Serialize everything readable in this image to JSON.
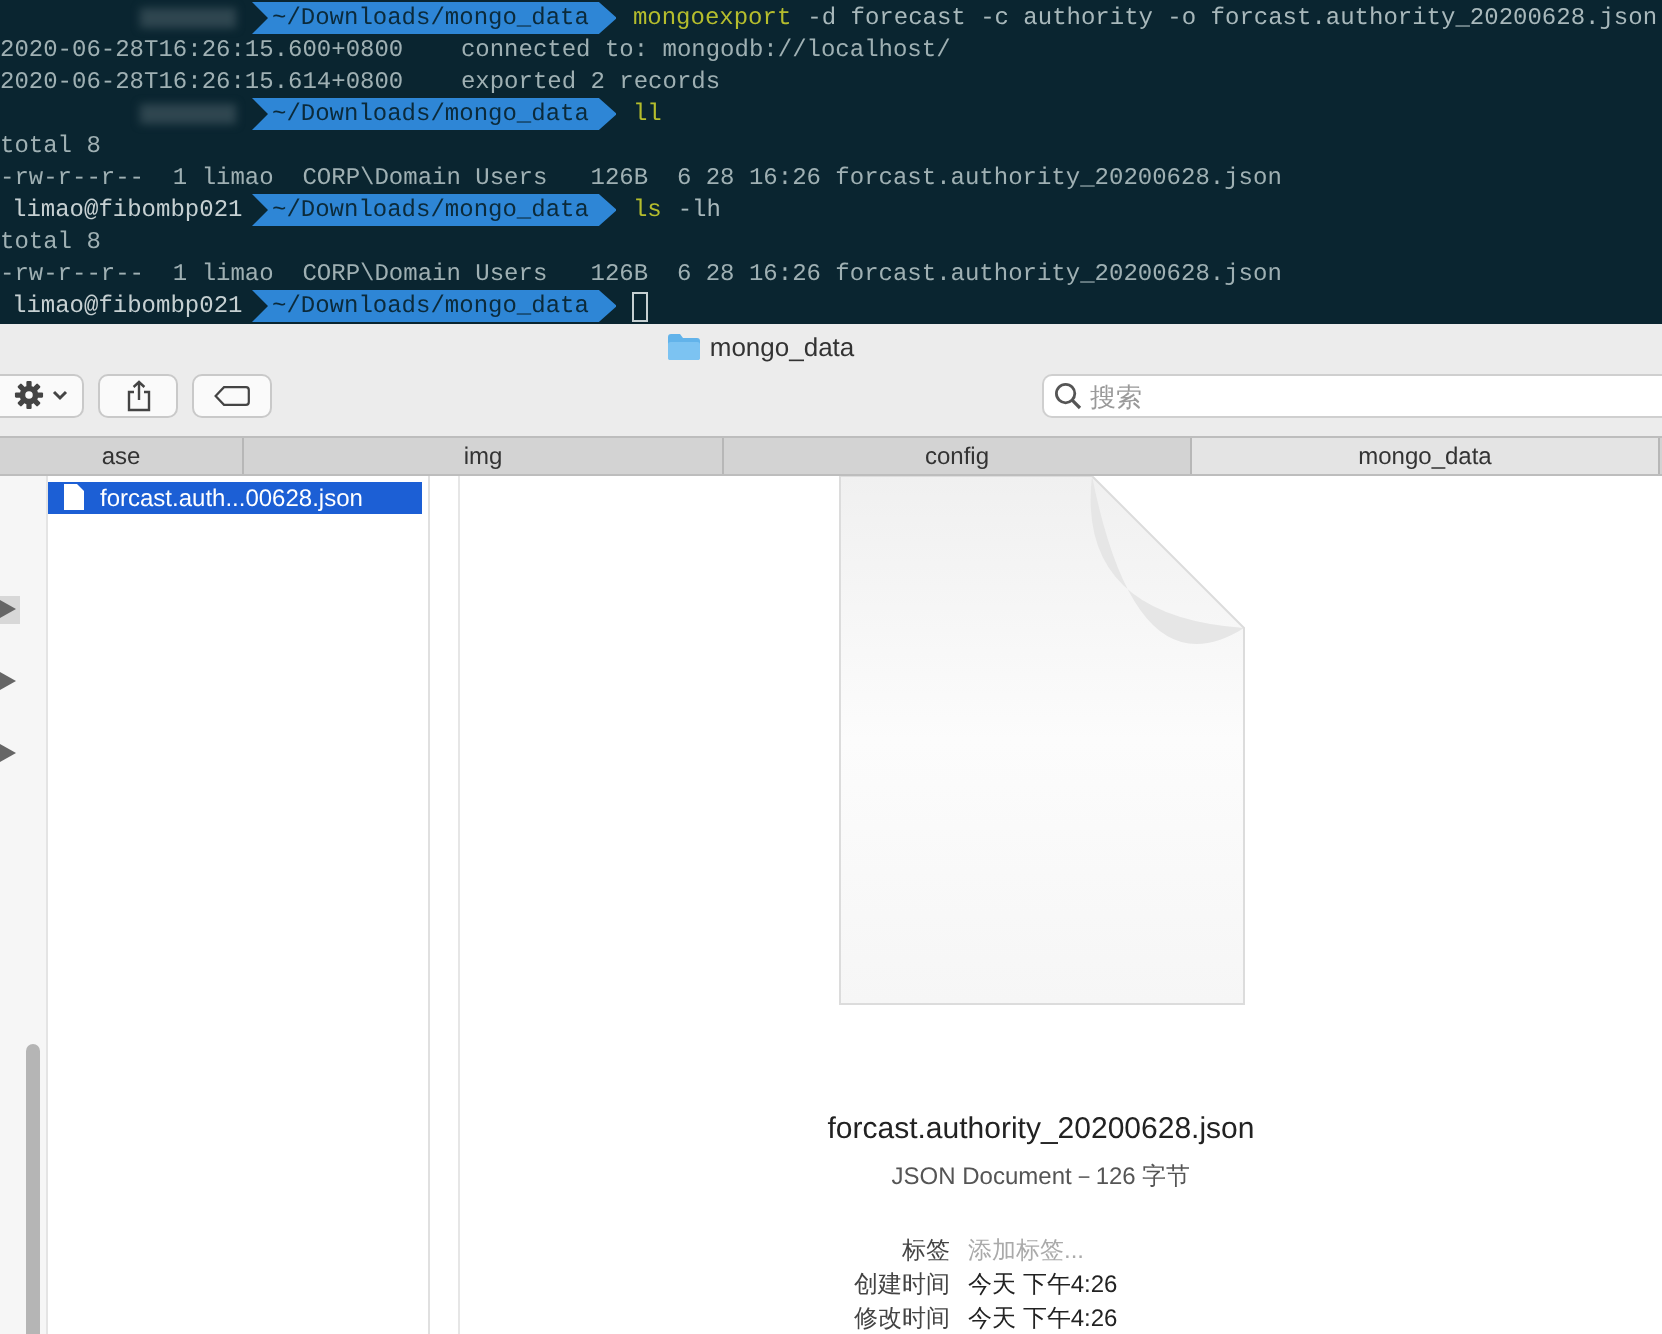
{
  "terminal": {
    "lines": [
      {
        "kind": "prompt",
        "blurred": true,
        "path": "~/Downloads/mongo_data",
        "command": "mongoexport",
        "args": "-d forecast -c authority -o forcast.authority_20200628.json"
      },
      {
        "kind": "output",
        "text": "2020-06-28T16:26:15.600+0800    connected to: mongodb://localhost/"
      },
      {
        "kind": "output",
        "text": "2020-06-28T16:26:15.614+0800    exported 2 records"
      },
      {
        "kind": "prompt",
        "blurred": true,
        "path": "~/Downloads/mongo_data",
        "command": "ll"
      },
      {
        "kind": "output",
        "text": "total 8"
      },
      {
        "kind": "output",
        "text": "-rw-r--r--  1 limao  CORP\\Domain Users   126B  6 28 16:26 forcast.authority_20200628.json"
      },
      {
        "kind": "prompt",
        "blurred": false,
        "user": "limao@fibombp021",
        "path": "~/Downloads/mongo_data",
        "command": "ls",
        "args": "-lh"
      },
      {
        "kind": "output",
        "text": "total 8"
      },
      {
        "kind": "output",
        "text": "-rw-r--r--  1 limao  CORP\\Domain Users   126B  6 28 16:26 forcast.authority_20200628.json"
      },
      {
        "kind": "prompt",
        "blurred": false,
        "user": "limao@fibombp021",
        "path": "~/Downloads/mongo_data",
        "cursor": true
      }
    ]
  },
  "finder": {
    "title": "mongo_data",
    "search": {
      "placeholder": "搜索"
    },
    "path_tabs": [
      {
        "label": "ase",
        "selected": false
      },
      {
        "label": "img",
        "selected": false
      },
      {
        "label": "config",
        "selected": false
      },
      {
        "label": "mongo_data",
        "selected": true
      }
    ],
    "left_column": [
      {
        "selected": true
      },
      {
        "selected": false
      },
      {
        "selected": false
      }
    ],
    "files": [
      {
        "name": "forcast.auth...00628.json",
        "selected": true
      }
    ],
    "preview": {
      "name": "forcast.authority_20200628.json",
      "kind": "JSON Document－126 字节",
      "info": [
        {
          "label": "标签",
          "placeholder": "添加标签...",
          "kind": "field"
        },
        {
          "label": "创建时间",
          "value": "今天 下午4:26",
          "kind": "value"
        },
        {
          "label": "修改时间",
          "value": "今天 下午4:26",
          "kind": "value"
        }
      ]
    }
  }
}
